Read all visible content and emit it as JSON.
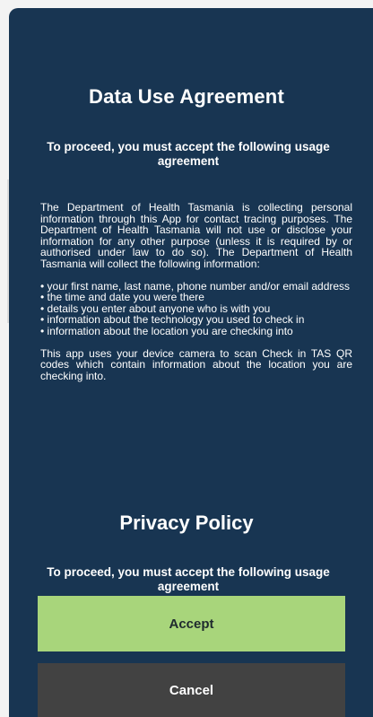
{
  "agreement": {
    "title": "Data Use Agreement",
    "subtitle": "To proceed, you must accept the following usage agreement",
    "intro": "The Department of Health Tasmania is collecting personal information through this App for contact tracing purposes. The Department of Health Tasmania will not use or disclose your information for any other purpose (unless it is required by or authorised under law to do so). The Department of Health Tasmania will collect the following information:",
    "items": [
      "• your first name, last name, phone number and/or email address",
      "• the time and date you were there",
      "• details you enter about anyone who is with you",
      "• information about the technology you used to check in",
      "• information about the location you are checking into"
    ],
    "camera_note": "This app uses your device camera to scan Check in TAS QR codes which contain information about the location you are checking into."
  },
  "privacy": {
    "title": "Privacy Policy",
    "subtitle": "To proceed, you must accept the following usage agreement"
  },
  "actions": {
    "accept_label": "Accept",
    "cancel_label": "Cancel"
  }
}
